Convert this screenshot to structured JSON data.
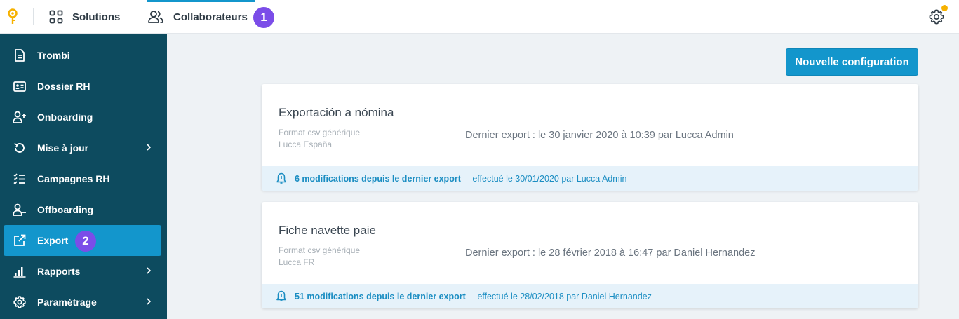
{
  "colors": {
    "accent": "#1396cc",
    "sidebar": "#0d4b5f",
    "badge": "#7b4de8",
    "notification": "#f6b100"
  },
  "topbar": {
    "solutions_label": "Solutions",
    "collab_label": "Collaborateurs",
    "badge_1": "1"
  },
  "sidebar": {
    "items": [
      {
        "label": "Trombi",
        "icon": "document-icon"
      },
      {
        "label": "Dossier RH",
        "icon": "id-card-icon"
      },
      {
        "label": "Onboarding",
        "icon": "user-add-icon"
      },
      {
        "label": "Mise à jour",
        "icon": "refresh-icon"
      },
      {
        "label": "Campagnes RH",
        "icon": "checklist-icon"
      },
      {
        "label": "Offboarding",
        "icon": "user-remove-icon"
      },
      {
        "label": "Export",
        "icon": "external-link-icon"
      },
      {
        "label": "Rapports",
        "icon": "bar-chart-icon"
      },
      {
        "label": "Paramétrage",
        "icon": "gear-icon"
      }
    ],
    "badge_2": "2"
  },
  "main": {
    "new_config_label": "Nouvelle configuration",
    "exports": [
      {
        "title": "Exportación a nómina",
        "format": "Format csv générique",
        "entity": "Lucca España",
        "last_export": "Dernier export : le 30 janvier 2020 à 10:39 par Lucca Admin",
        "modifications": "6 modifications depuis le dernier export",
        "done": "—effectué le 30/01/2020 par Lucca Admin"
      },
      {
        "title": "Fiche navette paie",
        "format": "Format csv générique",
        "entity": "Lucca FR",
        "last_export": "Dernier export : le 28 février 2018 à 16:47 par Daniel Hernandez",
        "modifications": "51 modifications depuis le dernier export",
        "done": "—effectué le 28/02/2018 par Daniel Hernandez"
      }
    ]
  }
}
